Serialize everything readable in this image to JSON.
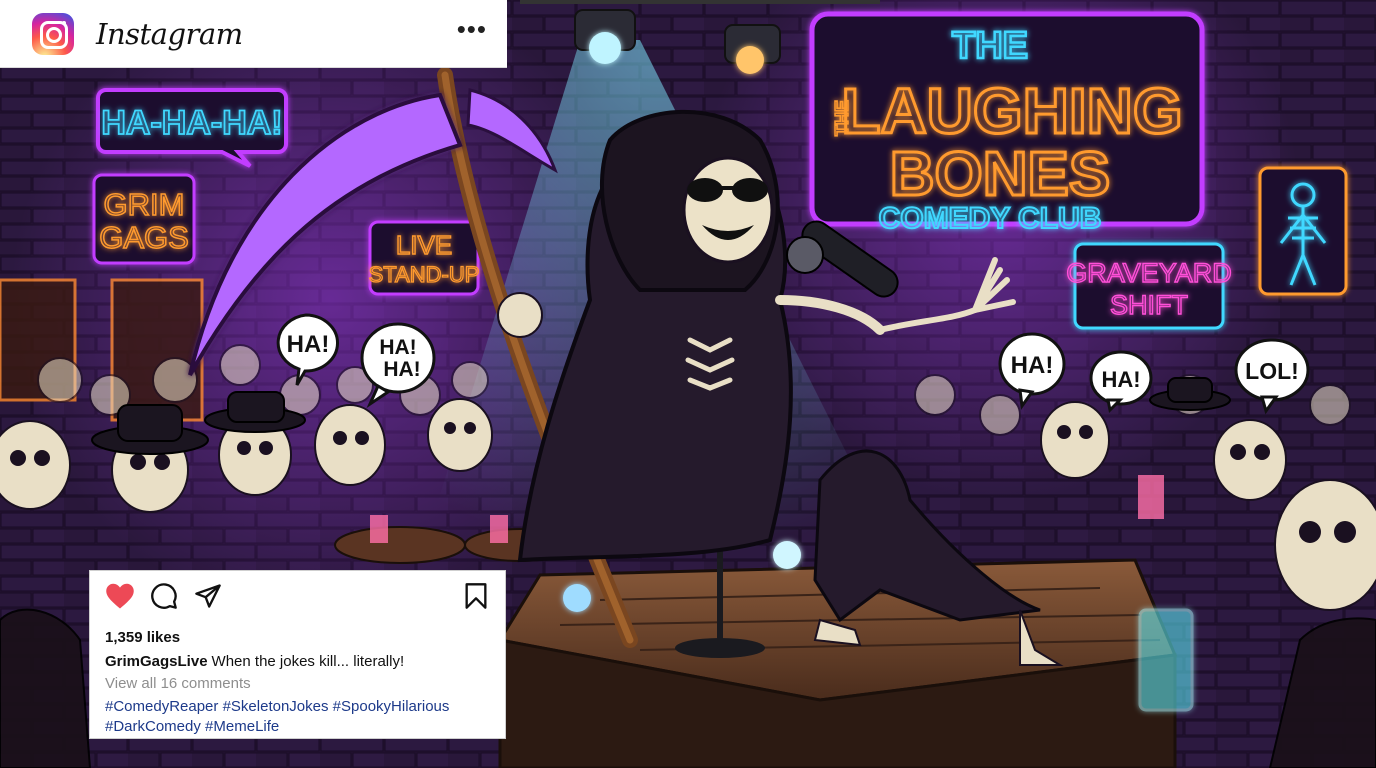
{
  "header": {
    "app_name": "Instagram",
    "more_icon": "more-horizontal-icon"
  },
  "scene": {
    "signs": {
      "club_the_top": "THE",
      "club_the_side": "THE",
      "club_name_line1": "LAUGHING",
      "club_name_line2": "BONES",
      "club_subtitle": "COMEDY CLUB",
      "ha_sign": "HA-HA-HA!",
      "grim_line1": "GRIM",
      "grim_line2": "GAGS",
      "live_line1": "LIVE",
      "live_line2": "STAND-UP",
      "graveyard_line1": "GRAVEYARD",
      "graveyard_line2": "SHIFT"
    },
    "bubbles": {
      "left_ha": "HA!",
      "left_haha_1": "HA!",
      "left_haha_2": "HA!",
      "right_ha_1": "HA!",
      "right_ha_2": "HA!",
      "right_lol": "LOL!"
    },
    "colors": {
      "neon_orange": "#ff9a2e",
      "neon_cyan": "#3fd8ff",
      "neon_purple": "#c23cff",
      "neon_pink": "#ff4fd8",
      "brick_bg": "#2a1838"
    }
  },
  "post": {
    "liked": true,
    "icons": {
      "like": "heart-icon",
      "comment": "comment-icon",
      "share": "send-icon",
      "save": "bookmark-icon"
    },
    "likes_text": "1,359 likes",
    "username": "GrimGagsLive",
    "caption": "When the jokes kill... literally!",
    "comments_link": "View all 16 comments",
    "hashtags_line1": [
      "#ComedyReaper",
      "#SkeletonJokes",
      "#SpookyHilarious"
    ],
    "hashtags_line2": [
      "#DarkComedy",
      "#MemeLife"
    ],
    "like_color": "#ed4956"
  }
}
